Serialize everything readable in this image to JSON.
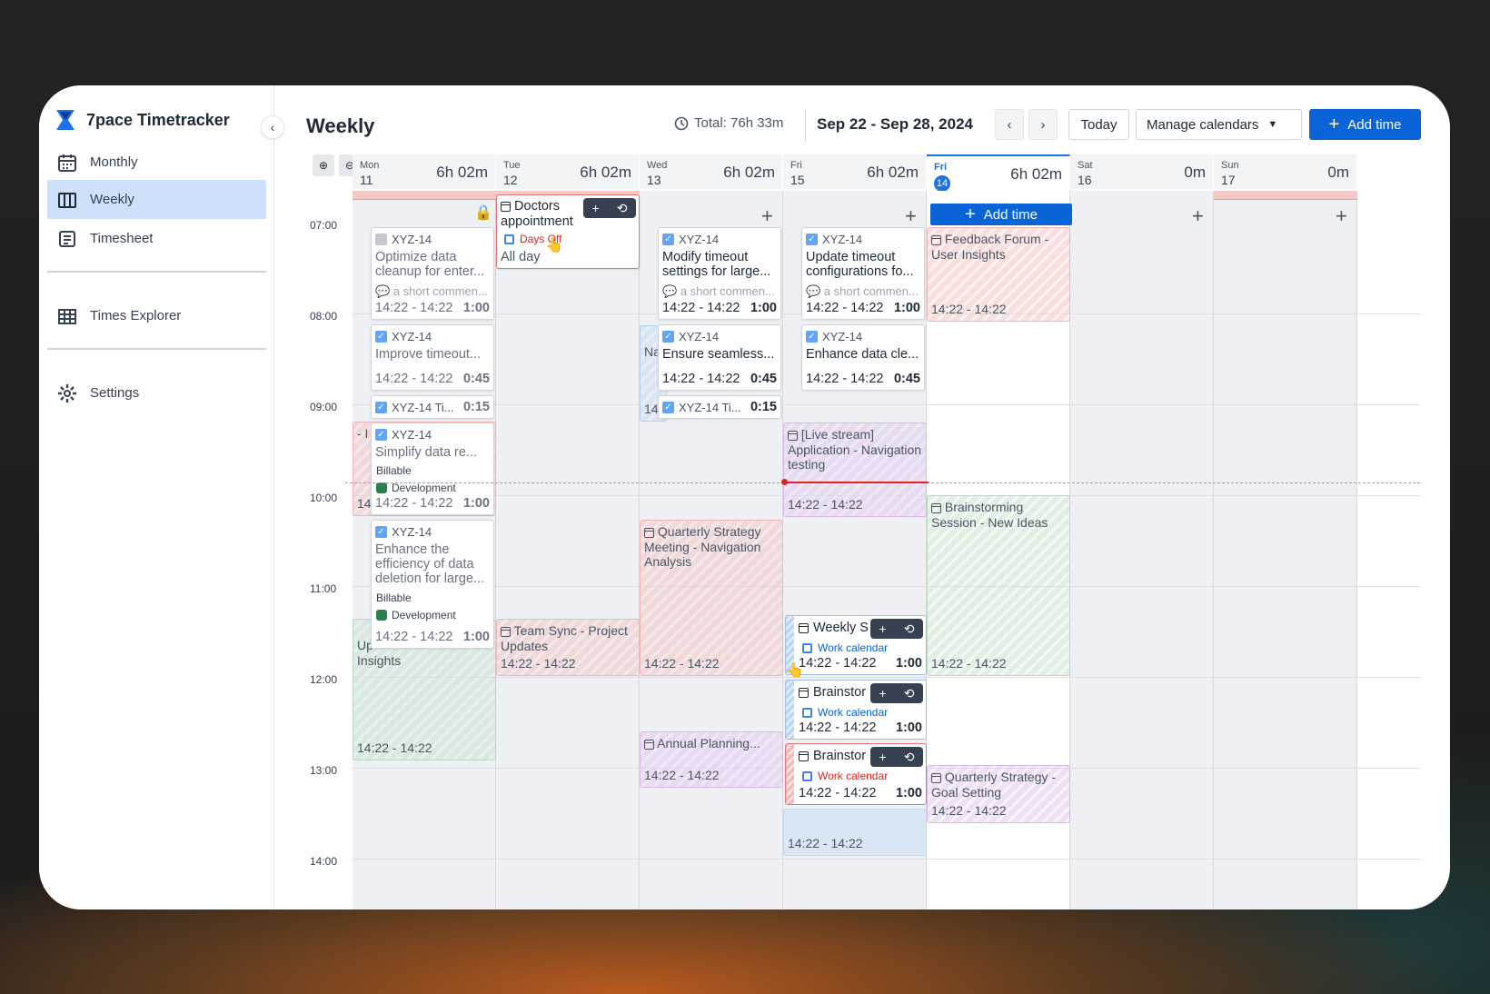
{
  "app": {
    "name": "7pace Timetracker"
  },
  "sidebar": {
    "items": [
      {
        "label": "Monthly"
      },
      {
        "label": "Weekly"
      },
      {
        "label": "Timesheet"
      },
      {
        "label": "Times Explorer"
      },
      {
        "label": "Settings"
      }
    ],
    "active": "Weekly"
  },
  "header": {
    "title": "Weekly",
    "total": "Total: 76h 33m",
    "range": "Sep 22 - Sep 28, 2024",
    "today": "Today",
    "manage": "Manage calendars",
    "add": "Add time"
  },
  "days": [
    {
      "name": "Mon",
      "num": "11",
      "total": "6h 02m"
    },
    {
      "name": "Tue",
      "num": "12",
      "total": "6h 02m"
    },
    {
      "name": "Wed",
      "num": "13",
      "total": "6h 02m"
    },
    {
      "name": "Fri",
      "num": "15",
      "total": "6h 02m"
    },
    {
      "name": "Fri",
      "num": "14",
      "total": "6h 02m"
    },
    {
      "name": "Sat",
      "num": "16",
      "total": "0m"
    },
    {
      "name": "Sun",
      "num": "17",
      "total": "0m"
    }
  ],
  "times": [
    "07:00",
    "08:00",
    "09:00",
    "10:00",
    "11:00",
    "12:00",
    "13:00",
    "14:00"
  ],
  "events": {
    "mon_red": {
      "t": "- I",
      "b": "14"
    },
    "mon_green": {
      "t": "Up Insights",
      "b": "14:22 - 14:22"
    },
    "tue_team": {
      "t": "Team Sync - Project Updates",
      "b": "14:22 - 14:22"
    },
    "wed_blue": {
      "t": "Na",
      "b": "14"
    },
    "wed_quarterly": {
      "t": "Quarterly Strategy Meeting - Navigation Analysis",
      "b": "14:22 - 14:22"
    },
    "wed_annual": {
      "t": "Annual Planning...",
      "b": "14:22 - 14:22"
    },
    "fri_live": {
      "t": "[Live stream] Application - Navigation testing",
      "b": "14:22 - 14:22"
    },
    "fri_blue": {
      "b": "14:22 - 14:22"
    },
    "fri2_feedback": {
      "t": "Feedback Forum - User Insights",
      "b": "14:22 - 14:22"
    },
    "fri2_brain": {
      "t": "Brainstorming Session - New Ideas",
      "b": "14:22 - 14:22"
    },
    "fri2_quarterly": {
      "t": "Quarterly Strategy - Goal Setting",
      "b": "14:22 - 14:22"
    }
  },
  "cards": {
    "c1": {
      "key": "XYZ-14",
      "title": "Optimize data cleanup for enter...",
      "comment": "a short commen...",
      "time": "14:22 - 14:22",
      "dur": "1:00"
    },
    "c2": {
      "key": "XYZ-14",
      "title": "Improve timeout...",
      "time": "14:22 - 14:22",
      "dur": "0:45"
    },
    "c3": {
      "key": "XYZ-14 Ti...",
      "dur": "0:15"
    },
    "c4": {
      "key": "XYZ-14",
      "title": "Simplify data re...",
      "billable": "Billable",
      "tag": "Development",
      "time": "14:22 - 14:22",
      "dur": "1:00"
    },
    "c5": {
      "key": "XYZ-14",
      "title": "Enhance the efficiency of data deletion for large...",
      "billable": "Billable",
      "tag": "Development",
      "time": "14:22 - 14:22",
      "dur": "1:00"
    },
    "doctors": {
      "title": "Doctors appointment",
      "cal": "Days Off",
      "allday": "All day"
    },
    "w1": {
      "key": "XYZ-14",
      "title": "Modify timeout settings for large...",
      "comment": "a short commen...",
      "time": "14:22 - 14:22",
      "dur": "1:00"
    },
    "w2": {
      "key": "XYZ-14",
      "title": "Ensure seamless...",
      "time": "14:22 - 14:22",
      "dur": "0:45"
    },
    "w3": {
      "key": "XYZ-14 Ti...",
      "dur": "0:15"
    },
    "f1": {
      "key": "XYZ-14",
      "title": "Update timeout configurations fo...",
      "comment": "a short commen...",
      "time": "14:22 - 14:22",
      "dur": "1:00"
    },
    "f2": {
      "key": "XYZ-14",
      "title": "Enhance data cle...",
      "time": "14:22 - 14:22",
      "dur": "0:45"
    },
    "g1": {
      "title": "Weekly S",
      "cal": "Work calendar",
      "time": "14:22 - 14:22",
      "dur": "1:00"
    },
    "g2": {
      "title": "Brainstor",
      "cal": "Work calendar",
      "time": "14:22 - 14:22",
      "dur": "1:00"
    },
    "g3": {
      "title": "Brainstor",
      "cal": "Work calendar",
      "time": "14:22 - 14:22",
      "dur": "1:00"
    }
  },
  "addtime_inline": "Add time",
  "colors": {
    "accent": "#0b63d8",
    "today": "#1d72e8",
    "nowline": "#dc2626"
  }
}
